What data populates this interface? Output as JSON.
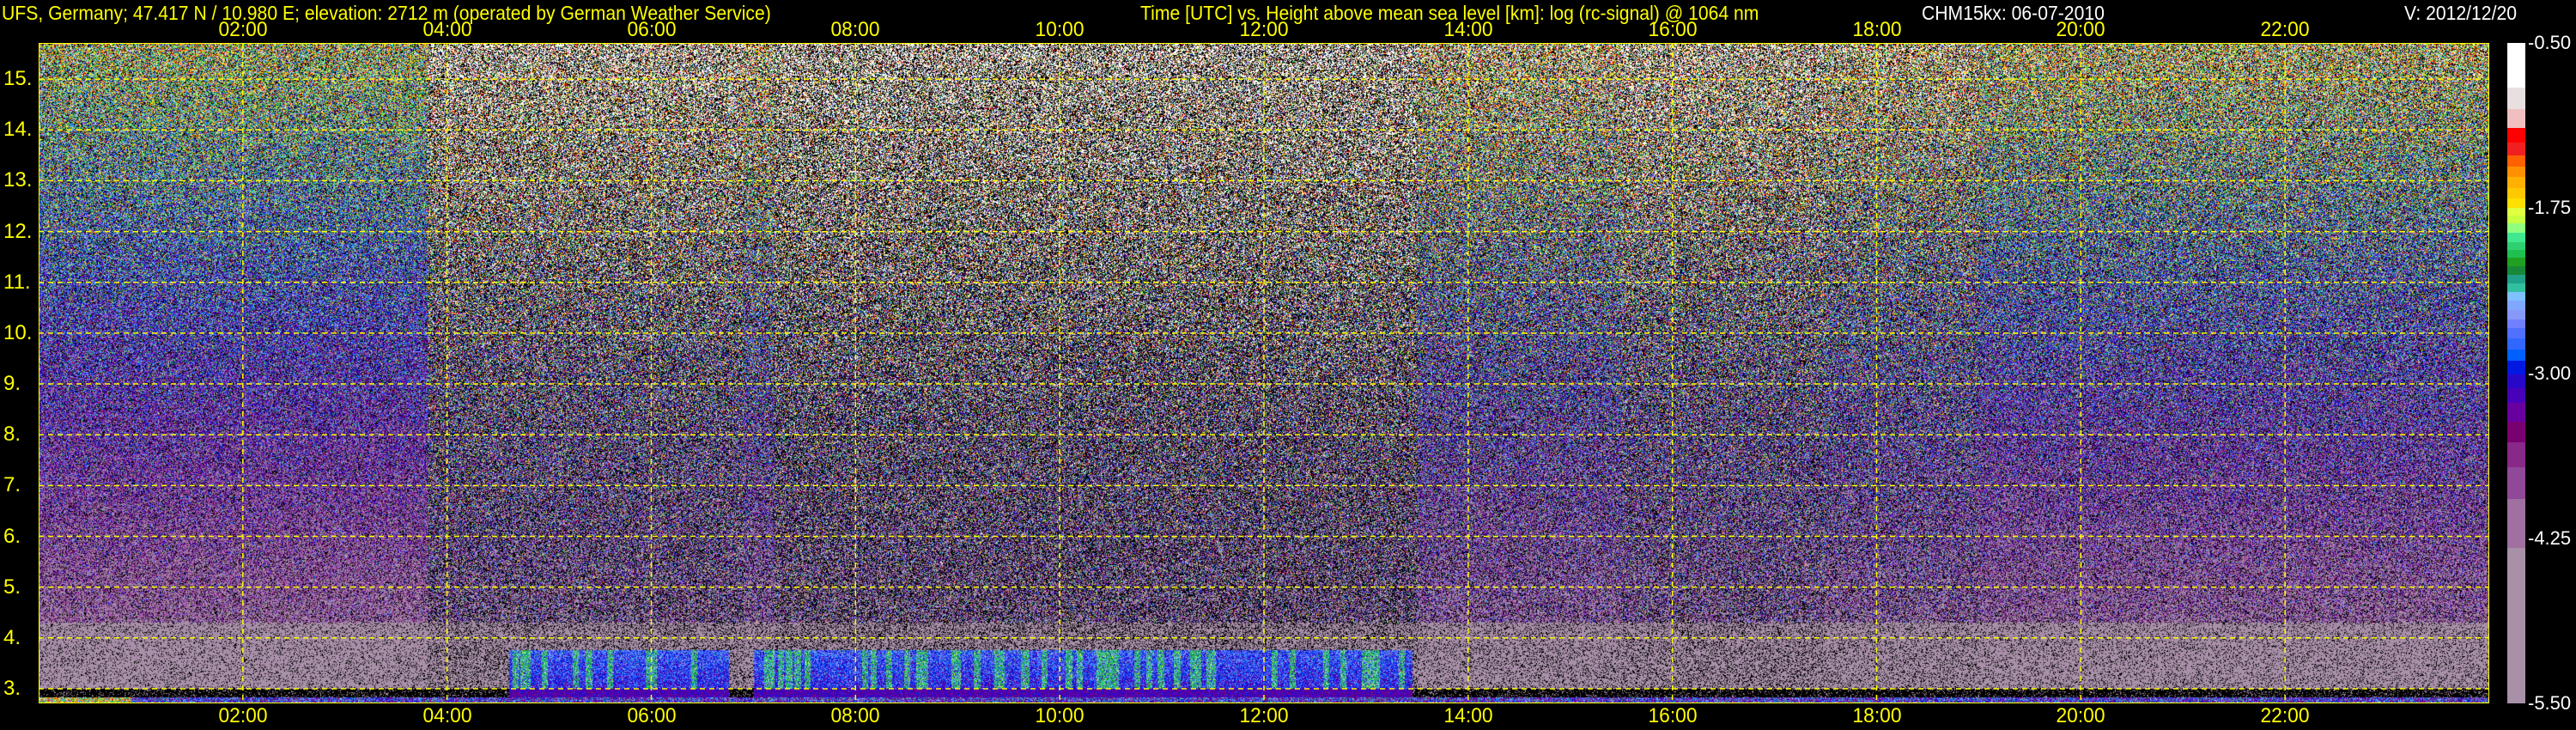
{
  "header": {
    "site": "UFS, Germany; 47.417 N / 10.980 E; elevation: 2712 m  (operated by German Weather Service)",
    "title": "Time [UTC] vs. Height above mean sea level [km]: log (rc-signal) @ 1064 nm",
    "instrument": "CHM15kx: 06-07-2010",
    "version": "V: 2012/12/20"
  },
  "chart_data": {
    "type": "heatmap",
    "title": "Time [UTC] vs. Height above mean sea level [km]: log (rc-signal) @ 1064 nm",
    "xlabel": "Time [UTC]",
    "ylabel": "Height above mean sea level [km]",
    "xlim": [
      0,
      24
    ],
    "ylim": [
      2.712,
      15.712
    ],
    "x_ticks": [
      2,
      4,
      6,
      8,
      10,
      12,
      14,
      16,
      18,
      20,
      22
    ],
    "x_tick_labels": [
      "02:00",
      "04:00",
      "06:00",
      "08:00",
      "10:00",
      "12:00",
      "14:00",
      "16:00",
      "18:00",
      "20:00",
      "22:00"
    ],
    "y_ticks": [
      3,
      4,
      5,
      6,
      7,
      8,
      9,
      10,
      11,
      12,
      13,
      14,
      15
    ],
    "y_tick_labels": [
      "3.",
      "4.",
      "5.",
      "6.",
      "7.",
      "8.",
      "9.",
      "10.",
      "11.",
      "12.",
      "13.",
      "14.",
      "15."
    ],
    "grid": true,
    "colorbar": {
      "range": [
        -5.5,
        -0.5
      ],
      "tick_labels": [
        "-0.50",
        "-1.75",
        "-3.00",
        "-4.25",
        "-5.50"
      ],
      "ticks": [
        -0.5,
        -1.75,
        -3.0,
        -4.25,
        -5.5
      ],
      "colors": [
        "#ffffff",
        "#e8dfe0",
        "#f0c0c0",
        "#ff0000",
        "#f02020",
        "#ff6000",
        "#ff9000",
        "#ffb000",
        "#ffc800",
        "#ffe000",
        "#e0ff40",
        "#c8ff40",
        "#90ff80",
        "#40e890",
        "#30d070",
        "#20c050",
        "#20a020",
        "#188838",
        "#20a088",
        "#30c0a0",
        "#80c0ff",
        "#80a8ff",
        "#8898f8",
        "#7080ff",
        "#5070ff",
        "#3068ff",
        "#0060ff",
        "#0018e0",
        "#2808c8",
        "#4800b8",
        "#6800a0",
        "#780070",
        "#882888",
        "#904898",
        "#a070a0",
        "#a890a8"
      ]
    },
    "regions": [
      {
        "time": [
          0,
          3.8
        ],
        "description_level": 0.2
      },
      {
        "time": [
          3.8,
          6.9
        ],
        "description_level": 0.8
      },
      {
        "time": [
          7.2,
          13.5
        ],
        "description_level": 1.0
      },
      {
        "time": [
          13.5,
          15.5
        ],
        "description_level": 0.45
      },
      {
        "time": [
          15.5,
          17.5
        ],
        "description_level": 0.7
      },
      {
        "time": [
          19,
          24
        ],
        "description_level": 0.3
      }
    ]
  },
  "colors": {
    "axis": "#ffff00",
    "text": "#ffff00",
    "instrument_text": "#ffffff"
  }
}
